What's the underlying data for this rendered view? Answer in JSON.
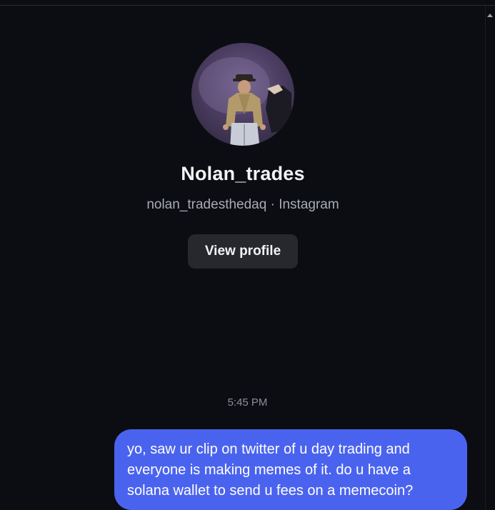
{
  "profile": {
    "name": "Nolan_trades",
    "subtitle": "nolan_tradesthedaq · Instagram",
    "view_profile_label": "View profile"
  },
  "conversation": {
    "timestamp": "5:45 PM",
    "messages": [
      {
        "sender": "self",
        "text": "yo, saw ur clip on twitter of u day trading and everyone is making memes of it. do u have a solana wallet to send u fees on a memecoin?"
      }
    ]
  },
  "colors": {
    "background": "#0b0d12",
    "bubble": "#4a63ef",
    "button": "#26282d"
  }
}
